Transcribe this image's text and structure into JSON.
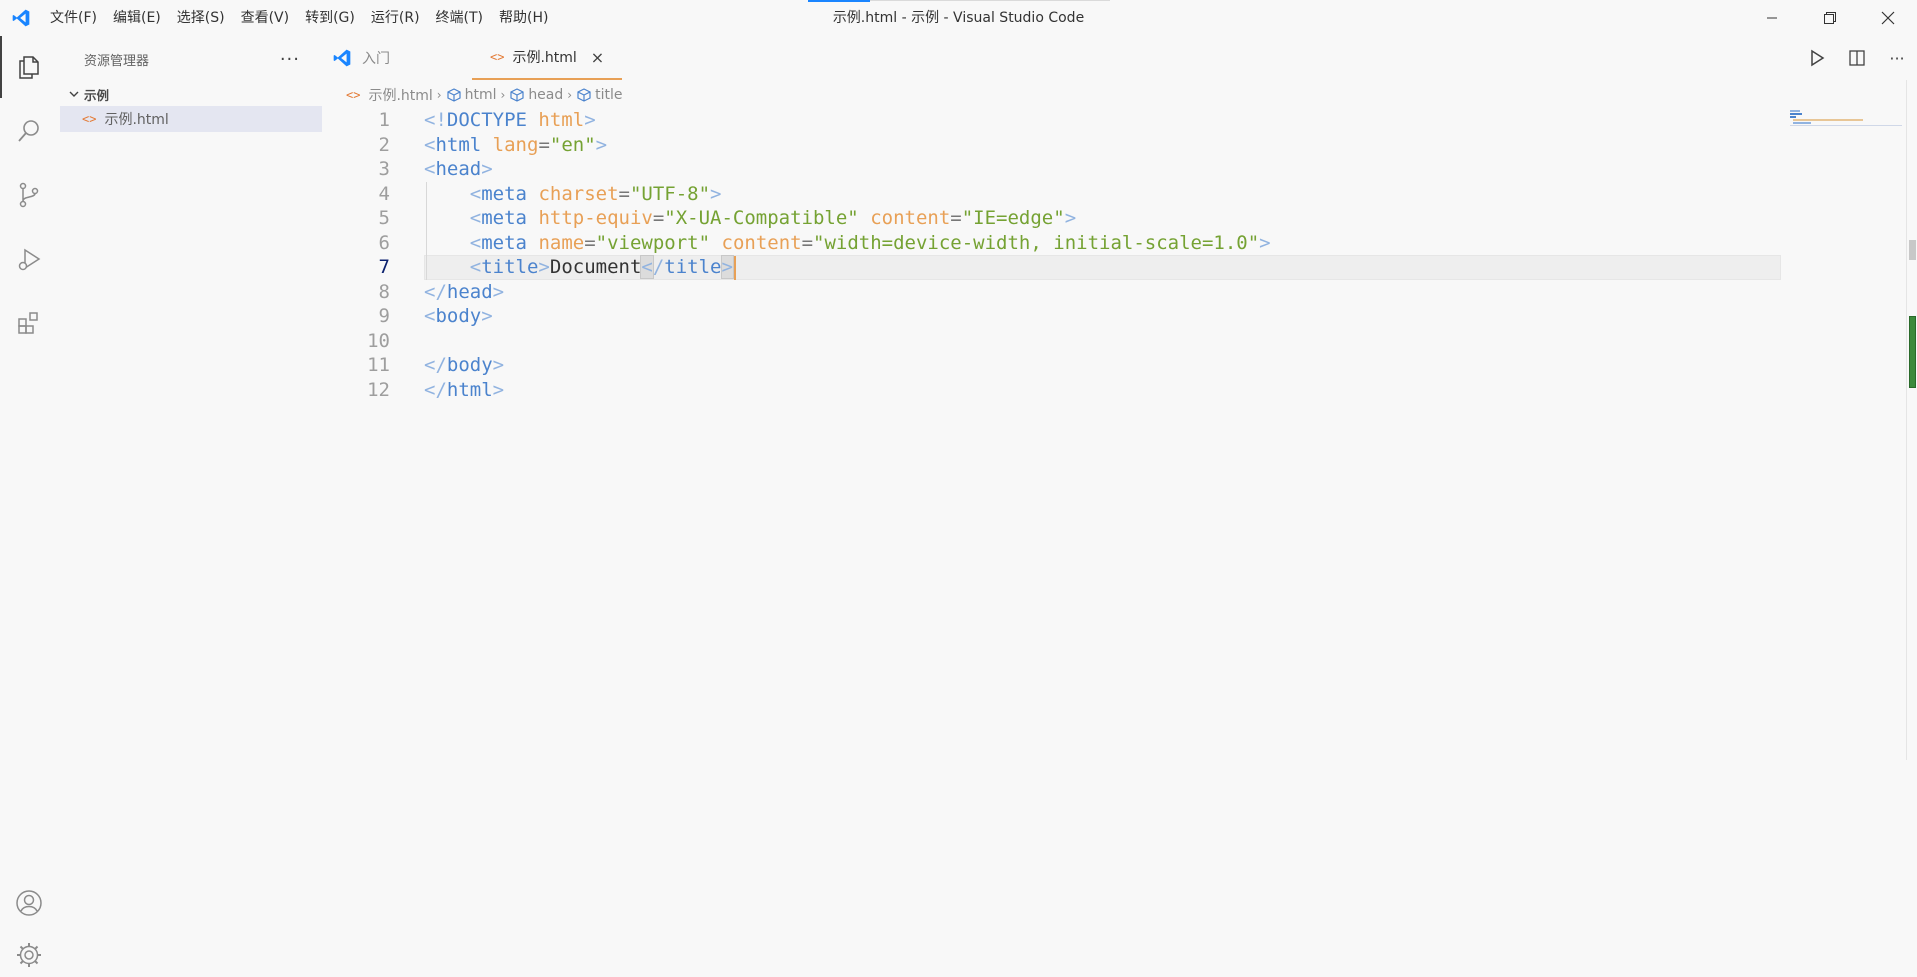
{
  "window": {
    "title": "示例.html - 示例 - Visual Studio Code",
    "menu": [
      "文件(F)",
      "编辑(E)",
      "选择(S)",
      "查看(V)",
      "转到(G)",
      "运行(R)",
      "终端(T)",
      "帮助(H)"
    ]
  },
  "colors": {
    "accent": "#1a85ff",
    "tab_active_border": "#e8a056",
    "tag": "#4b83cd",
    "attribute": "#e8a056",
    "string": "#75a233"
  },
  "activitybar": {
    "items": [
      "files-icon",
      "search-icon",
      "source-control-icon",
      "run-debug-icon",
      "extensions-icon"
    ],
    "bottom": [
      "account-icon",
      "settings-gear-icon"
    ]
  },
  "sidebar": {
    "header": "资源管理器",
    "more": "···",
    "folder": "示例",
    "files": [
      "示例.html"
    ]
  },
  "tabs": {
    "welcome": "入门",
    "active": "示例.html",
    "close": "×"
  },
  "breadcrumbs": {
    "file": "示例.html",
    "items": [
      "html",
      "head",
      "title"
    ]
  },
  "editor": {
    "current_line": 7,
    "line_numbers": [
      "1",
      "2",
      "3",
      "4",
      "5",
      "6",
      "7",
      "8",
      "9",
      "10",
      "11",
      "12"
    ],
    "lines": [
      [
        [
          "p",
          "<!"
        ],
        [
          "d",
          "DOCTYPE"
        ],
        [
          "x",
          " "
        ],
        [
          "a",
          "html"
        ],
        [
          "p",
          ">"
        ]
      ],
      [
        [
          "p",
          "<"
        ],
        [
          "t",
          "html"
        ],
        [
          "x",
          " "
        ],
        [
          "a",
          "lang"
        ],
        [
          "e",
          "="
        ],
        [
          "s",
          "\"en\""
        ],
        [
          "p",
          ">"
        ]
      ],
      [
        [
          "p",
          "<"
        ],
        [
          "t",
          "head"
        ],
        [
          "p",
          ">"
        ]
      ],
      [
        [
          "x",
          "    "
        ],
        [
          "p",
          "<"
        ],
        [
          "t",
          "meta"
        ],
        [
          "x",
          " "
        ],
        [
          "a",
          "charset"
        ],
        [
          "e",
          "="
        ],
        [
          "s",
          "\"UTF-8\""
        ],
        [
          "p",
          ">"
        ]
      ],
      [
        [
          "x",
          "    "
        ],
        [
          "p",
          "<"
        ],
        [
          "t",
          "meta"
        ],
        [
          "x",
          " "
        ],
        [
          "a",
          "http-equiv"
        ],
        [
          "e",
          "="
        ],
        [
          "s",
          "\"X-UA-Compatible\""
        ],
        [
          "x",
          " "
        ],
        [
          "a",
          "content"
        ],
        [
          "e",
          "="
        ],
        [
          "s",
          "\"IE=edge\""
        ],
        [
          "p",
          ">"
        ]
      ],
      [
        [
          "x",
          "    "
        ],
        [
          "p",
          "<"
        ],
        [
          "t",
          "meta"
        ],
        [
          "x",
          " "
        ],
        [
          "a",
          "name"
        ],
        [
          "e",
          "="
        ],
        [
          "s",
          "\"viewport\""
        ],
        [
          "x",
          " "
        ],
        [
          "a",
          "content"
        ],
        [
          "e",
          "="
        ],
        [
          "s",
          "\"width=device-width, initial-scale=1.0\""
        ],
        [
          "p",
          ">"
        ]
      ],
      [
        [
          "x",
          "    "
        ],
        [
          "p",
          "<"
        ],
        [
          "t",
          "title"
        ],
        [
          "p",
          ">"
        ],
        [
          "x",
          "Document"
        ],
        [
          "h",
          "<"
        ],
        [
          "p",
          "/"
        ],
        [
          "t",
          "title"
        ],
        [
          "h",
          ">"
        ]
      ],
      [
        [
          "p",
          "</"
        ],
        [
          "t",
          "head"
        ],
        [
          "p",
          ">"
        ]
      ],
      [
        [
          "p",
          "<"
        ],
        [
          "t",
          "body"
        ],
        [
          "p",
          ">"
        ]
      ],
      [],
      [
        [
          "p",
          "</"
        ],
        [
          "t",
          "body"
        ],
        [
          "p",
          ">"
        ]
      ],
      [
        [
          "p",
          "</"
        ],
        [
          "t",
          "html"
        ],
        [
          "p",
          ">"
        ]
      ]
    ]
  }
}
